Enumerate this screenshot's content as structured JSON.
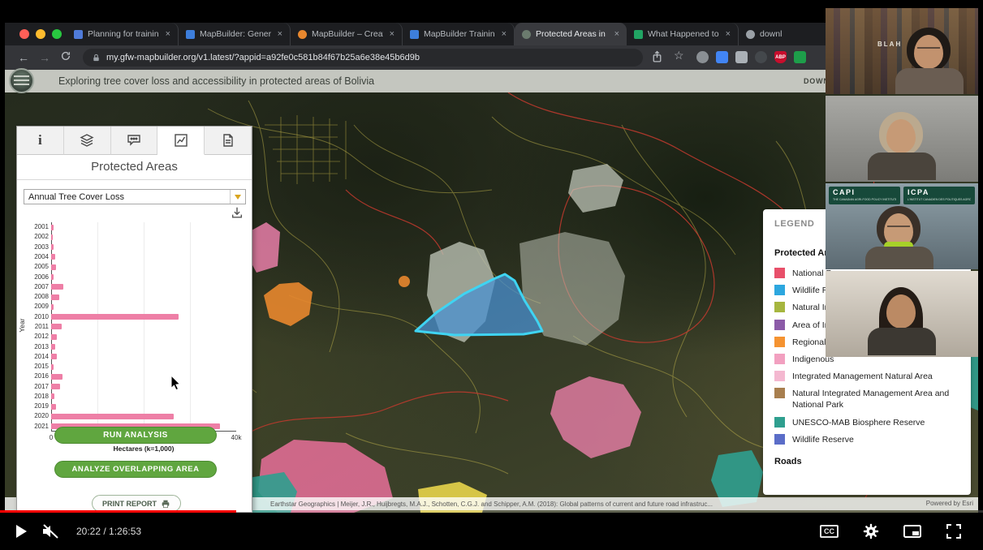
{
  "player": {
    "time_display": "20:22 / 1:26:53",
    "progress_pct": 24,
    "cc_label": "CC"
  },
  "browser": {
    "tabs": [
      {
        "title": "Planning for trainin",
        "favicon_color": "#4f7bd9",
        "shape": "square",
        "active": false
      },
      {
        "title": "MapBuilder: Gener",
        "favicon_color": "#3d7edb",
        "shape": "square",
        "active": false
      },
      {
        "title": "MapBuilder – Creat",
        "favicon_color": "#e8872e",
        "shape": "round",
        "active": false
      },
      {
        "title": "MapBuilder Training",
        "favicon_color": "#3d7edb",
        "shape": "square",
        "active": false
      },
      {
        "title": "Protected Areas in",
        "favicon_color": "#6b7b6e",
        "shape": "round",
        "active": true
      },
      {
        "title": "What Happened to",
        "favicon_color": "#21a463",
        "shape": "square",
        "active": false
      },
      {
        "title": "downl",
        "favicon_color": "#9aa0a6",
        "shape": "round",
        "active": false
      }
    ],
    "url": "my.gfw-mapbuilder.org/v1.latest/?appid=a92fe0c581b84f67b25a6e38e45b6d9b",
    "extensions": [
      {
        "name": "extension-avatar-icon",
        "color": "#8a8f94",
        "shape": "circle",
        "label": ""
      },
      {
        "name": "extension-blue-icon",
        "color": "#4285f4",
        "shape": "square",
        "label": ""
      },
      {
        "name": "extension-keyboard-icon",
        "color": "#aab0b6",
        "shape": "square",
        "label": ""
      },
      {
        "name": "extension-dark-icon",
        "color": "#44484c",
        "shape": "circle",
        "label": ""
      },
      {
        "name": "adblock-plus-icon",
        "color": "#c70d2c",
        "shape": "shield",
        "label": "ABP"
      },
      {
        "name": "extension-green-icon",
        "color": "#1e9e4a",
        "shape": "square",
        "label": ""
      }
    ]
  },
  "app_header": {
    "title": "Exploring tree cover loss and accessibility in protected areas of Bolivia",
    "download_label": "DOWNLOAD DA"
  },
  "panel": {
    "title": "Protected Areas",
    "dropdown_value": "Annual Tree Cover Loss",
    "run_label": "RUN ANALYSIS",
    "overlap_label": "ANALYZE OVERLAPPING AREA",
    "print_label": "PRINT REPORT"
  },
  "chart_data": {
    "type": "bar",
    "orientation": "horizontal",
    "title": "Annual Tree Cover Loss",
    "categories": [
      "2001",
      "2002",
      "2003",
      "2004",
      "2005",
      "2006",
      "2007",
      "2008",
      "2009",
      "2010",
      "2011",
      "2012",
      "2013",
      "2014",
      "2015",
      "2016",
      "2017",
      "2018",
      "2019",
      "2020",
      "2021"
    ],
    "values": [
      0.6,
      0.4,
      0.5,
      0.9,
      1.0,
      0.5,
      2.6,
      1.7,
      0.6,
      27.5,
      2.3,
      1.3,
      0.9,
      1.2,
      0.5,
      2.4,
      2.0,
      0.7,
      1.1,
      26.5,
      36.5
    ],
    "xlabel": "Hectares (k=1,000)",
    "ylabel": "Year",
    "xlim": [
      0,
      40
    ],
    "xticks": [
      "0",
      "10k",
      "20k",
      "30k",
      "40k"
    ],
    "grid": true,
    "bar_color": "#ee7fa6",
    "units": "thousand hectares"
  },
  "legend": {
    "title": "LEGEND",
    "section": "Protected Area",
    "items": [
      {
        "label": "National Par",
        "color": "#e8506a"
      },
      {
        "label": "Wildlife Re",
        "color": "#2da7df"
      },
      {
        "label": "Natural Int",
        "color": "#a6b63f"
      },
      {
        "label": "Area of Im",
        "color": "#8c5ba8"
      },
      {
        "label": "Regional P",
        "color": "#f59331"
      },
      {
        "label": "Indigenous",
        "color": "#f2a0c0"
      },
      {
        "label": "Integrated Management Natural Area",
        "color": "#f4b8d0"
      },
      {
        "label": "Natural Integrated Management Area and National Park",
        "color": "#a87f4f"
      },
      {
        "label": "UNESCO-MAB Biosphere Reserve",
        "color": "#2f9f8f"
      },
      {
        "label": "Wildlife Reserve",
        "color": "#5b6dc8"
      }
    ],
    "roads_title": "Roads"
  },
  "map": {
    "attribution": "Earthstar Geographics | Meijer, J.R., Huijbregts, M.A.J., Schotten, C.G.J. and Schipper, A.M. (2018): Global patterns of current and future road infrastruc...",
    "powered_by": "Powered by Esri",
    "highlight_fill": "#4a90d0",
    "highlight_stroke": "#3fd4f2"
  },
  "webcams": [
    {
      "name": "participant-1",
      "poster_text": "BLAH"
    },
    {
      "name": "participant-2"
    },
    {
      "name": "participant-3",
      "logos": [
        {
          "abbr": "CAPI",
          "sub": "THE CANADIAN AGRI-FOOD POLICY INSTITUTE"
        },
        {
          "abbr": "ICPA",
          "sub": "L'INSTITUT CANADIEN DES POLITIQUES AGROALIMENTAIRES"
        }
      ]
    },
    {
      "name": "participant-4"
    }
  ]
}
